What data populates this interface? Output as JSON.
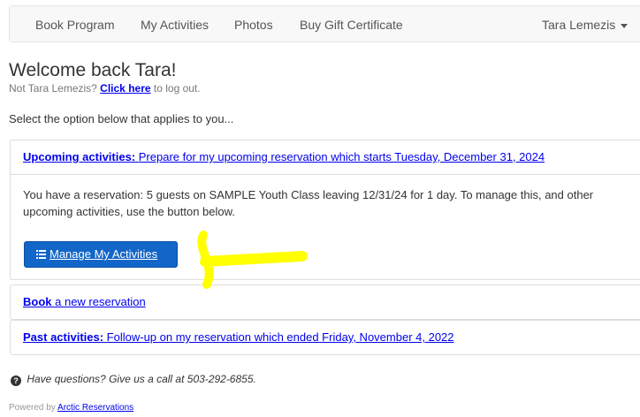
{
  "nav": {
    "items": [
      {
        "label": "Book Program"
      },
      {
        "label": "My Activities"
      },
      {
        "label": "Photos"
      },
      {
        "label": "Buy Gift Certificate"
      }
    ],
    "user_menu": "Tara Lemezis"
  },
  "welcome": {
    "title": "Welcome back Tara!",
    "not_user": "Not Tara Lemezis?",
    "logout_link": "Click here",
    "logout_suffix": "to log out."
  },
  "select_prompt": "Select the option below that applies to you...",
  "upcoming": {
    "heading_strong": "Upcoming activities:",
    "heading_text": "Prepare for my upcoming reservation which starts Tuesday, December 31, 2024",
    "body_line1": "You have a reservation: 5 guests on SAMPLE Youth Class leaving 12/31/24 for 1 day. To manage this, and other",
    "body_line2": "upcoming activities, use the button below.",
    "button_label": "Manage My Activities"
  },
  "book": {
    "strong": "Book",
    "text": "a new reservation"
  },
  "past": {
    "heading_strong": "Past activities:",
    "heading_text": "Follow-up on my reservation which ended Friday, November 4, 2022"
  },
  "help": {
    "text": "Have questions? Give us a call at 503-292-6855."
  },
  "footer": {
    "prefix": "Powered by",
    "link": "Arctic Reservations"
  },
  "colors": {
    "link": "#0000ee",
    "button": "#1266c8",
    "highlight_arrow": "#ffff00",
    "navbar_bg": "#f8f8f8"
  }
}
